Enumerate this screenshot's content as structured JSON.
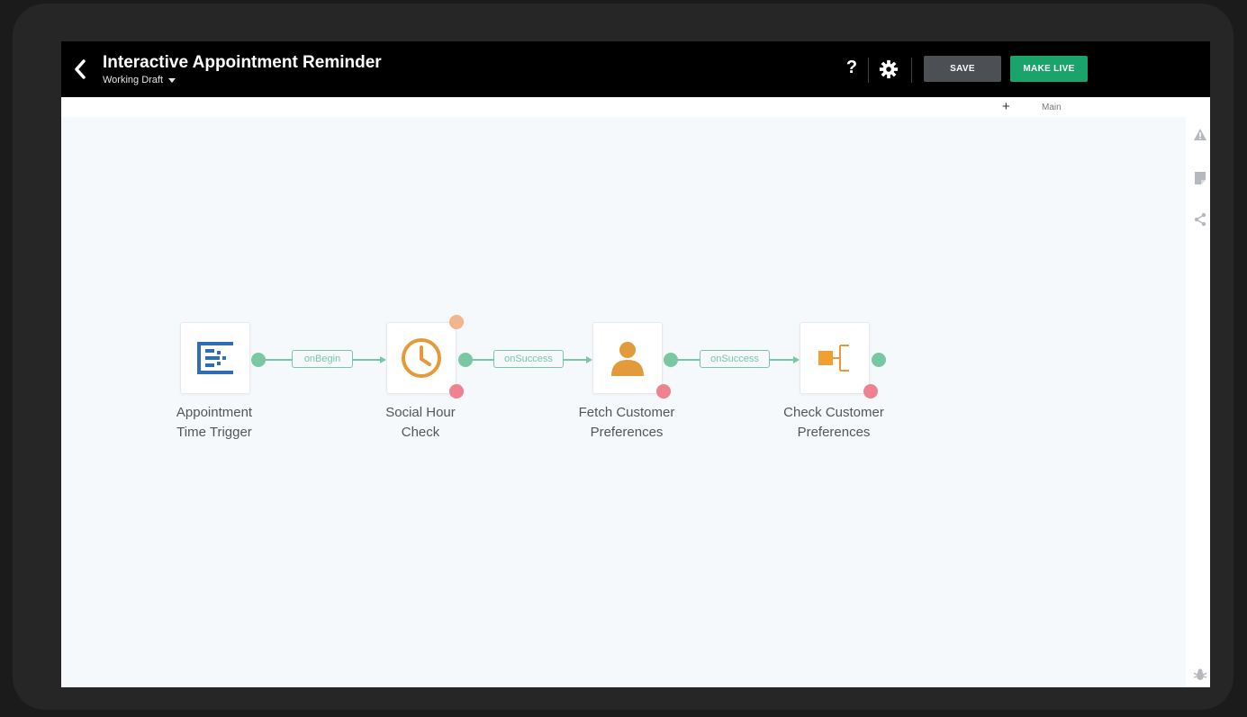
{
  "header": {
    "title": "Interactive Appointment Reminder",
    "subtitle": "Working Draft",
    "help_label": "?",
    "save_label": "SAVE",
    "make_live_label": "MAKE LIVE"
  },
  "toolbar": {
    "add_label": "+",
    "tab_label": "Main"
  },
  "flow": {
    "nodes": [
      {
        "label_line1": "Appointment",
        "label_line2": "Time Trigger",
        "icon": "trigger-icon"
      },
      {
        "label_line1": "Social Hour",
        "label_line2": "Check",
        "icon": "clock-icon"
      },
      {
        "label_line1": "Fetch Customer",
        "label_line2": "Preferences",
        "icon": "person-icon"
      },
      {
        "label_line1": "Check Customer",
        "label_line2": "Preferences",
        "icon": "branch-icon"
      }
    ],
    "edges": [
      {
        "label": "onBegin"
      },
      {
        "label": "onSuccess"
      },
      {
        "label": "onSuccess"
      }
    ]
  },
  "right_rail": {
    "icons": [
      "warning-icon",
      "note-icon",
      "share-icon",
      "bug-icon"
    ]
  },
  "colors": {
    "accent_green": "#1aa36b",
    "port_green": "#7ac7a4",
    "port_red": "#ef8290",
    "port_orange": "#f2b58d",
    "clock_orange": "#e39a3a",
    "trigger_blue": "#2f6db5"
  }
}
